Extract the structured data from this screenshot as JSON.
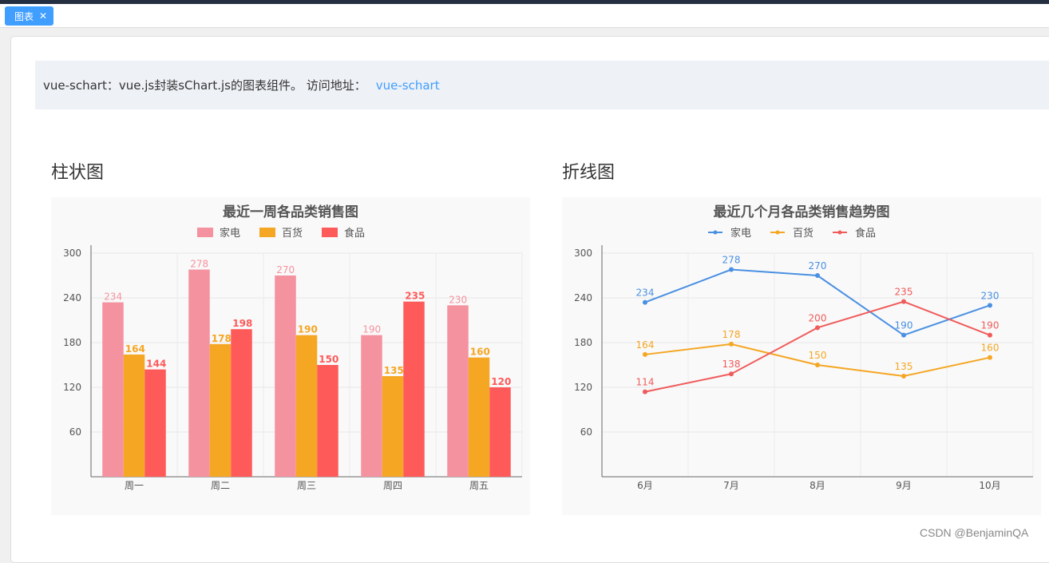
{
  "tabs": [
    {
      "label": "图表"
    }
  ],
  "info": {
    "text": "vue-schart：vue.js封装sChart.js的图表组件。 访问地址：",
    "link": "vue-schart"
  },
  "sections": {
    "bar_title": "柱状图",
    "line_title": "折线图"
  },
  "watermark": "CSDN @BenjaminQA",
  "colors": {
    "accent": "#409eff",
    "series_bar": [
      "#f5929f",
      "#f5a623",
      "#ff5a5a"
    ],
    "series_line": [
      "#4a90e2",
      "#f5a623",
      "#f05b5b"
    ]
  },
  "chart_data": [
    {
      "type": "bar",
      "title": "最近一周各品类销售图",
      "categories": [
        "周一",
        "周二",
        "周三",
        "周四",
        "周五"
      ],
      "series": [
        {
          "name": "家电",
          "values": [
            234,
            278,
            270,
            190,
            230
          ]
        },
        {
          "name": "百货",
          "values": [
            164,
            178,
            190,
            135,
            160
          ]
        },
        {
          "name": "食品",
          "values": [
            144,
            198,
            150,
            235,
            120
          ]
        }
      ],
      "yticks": [
        60,
        120,
        180,
        240,
        300
      ],
      "ylim": [
        0,
        300
      ],
      "grid": true,
      "legend": "top-center"
    },
    {
      "type": "line",
      "title": "最近几个月各品类销售趋势图",
      "categories": [
        "6月",
        "7月",
        "8月",
        "9月",
        "10月"
      ],
      "series": [
        {
          "name": "家电",
          "values": [
            234,
            278,
            270,
            190,
            230
          ]
        },
        {
          "name": "百货",
          "values": [
            164,
            178,
            150,
            135,
            160
          ]
        },
        {
          "name": "食品",
          "values": [
            114,
            138,
            200,
            235,
            190
          ]
        }
      ],
      "yticks": [
        60,
        120,
        180,
        240,
        300
      ],
      "ylim": [
        0,
        300
      ],
      "grid": true,
      "legend": "top-center"
    }
  ]
}
